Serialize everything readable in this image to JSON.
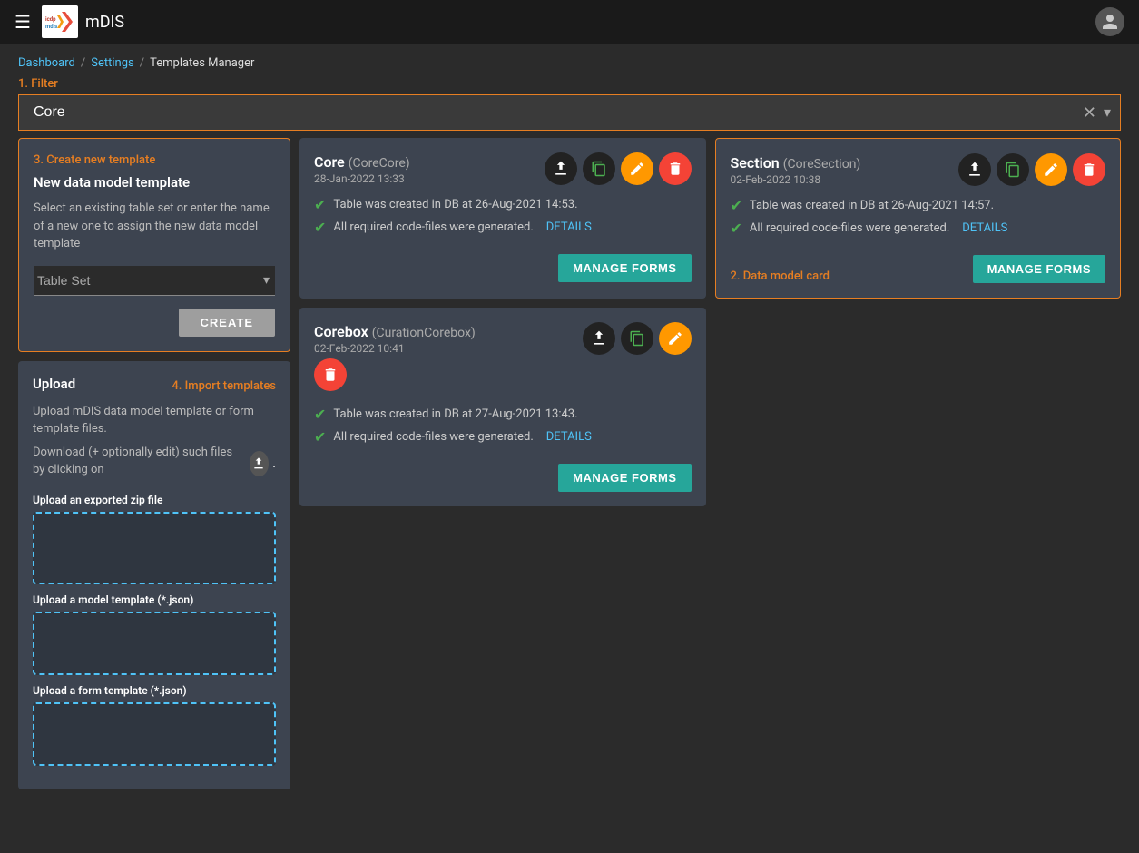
{
  "topnav": {
    "menu_icon": "☰",
    "logo_text": "icdp mdis",
    "app_title": "mDIS",
    "user_icon": "👤"
  },
  "breadcrumb": {
    "dashboard": "Dashboard",
    "settings": "Settings",
    "current": "Templates Manager"
  },
  "filter": {
    "label": "1. Filter",
    "placeholder": "Core",
    "value": "Core",
    "clear_icon": "✕",
    "dropdown_icon": "▾"
  },
  "sidebar": {
    "new_template": {
      "label": "3. Create new template",
      "title": "New data model template",
      "description": "Select an existing table set or enter the name of a new one to assign the new data model template",
      "table_set_placeholder": "Table Set",
      "create_btn": "CREATE"
    },
    "upload": {
      "label": "4. Import templates",
      "title": "Upload",
      "description_line1": "Upload mDIS data model template or form template files.",
      "description_line2": "Download (+ optionally edit) such files by clicking on",
      "description_suffix": ".",
      "upload_zip_label": "Upload an exported zip file",
      "upload_model_label": "Upload a model template (*.json)",
      "upload_form_label": "Upload a form template (*.json)"
    }
  },
  "cards": [
    {
      "id": "core",
      "title": "Core",
      "subtitle": "(CoreCore)",
      "date": "28-Jan-2022 13:33",
      "status1": "Table was created in DB at 26-Aug-2021 14:53.",
      "status2": "All required code-files were generated.",
      "details_label": "DETAILS",
      "manage_forms_label": "MANAGE FORMS",
      "highlighted": false
    },
    {
      "id": "section",
      "title": "Section",
      "subtitle": "(CoreSection)",
      "date": "02-Feb-2022 10:38",
      "status1": "Table was created in DB at 26-Aug-2021 14:57.",
      "status2": "All required code-files were generated.",
      "details_label": "DETAILS",
      "manage_forms_label": "MANAGE FORMS",
      "highlighted": true,
      "highlight_label": "2. Data model card"
    },
    {
      "id": "corebox",
      "title": "Corebox",
      "subtitle": "(CurationCorebox)",
      "date": "02-Feb-2022 10:41",
      "status1": "Table was created in DB at 27-Aug-2021 13:43.",
      "status2": "All required code-files were generated.",
      "details_label": "DETAILS",
      "manage_forms_label": "MANAGE FORMS",
      "highlighted": false,
      "no_delete_in_header": true
    }
  ]
}
